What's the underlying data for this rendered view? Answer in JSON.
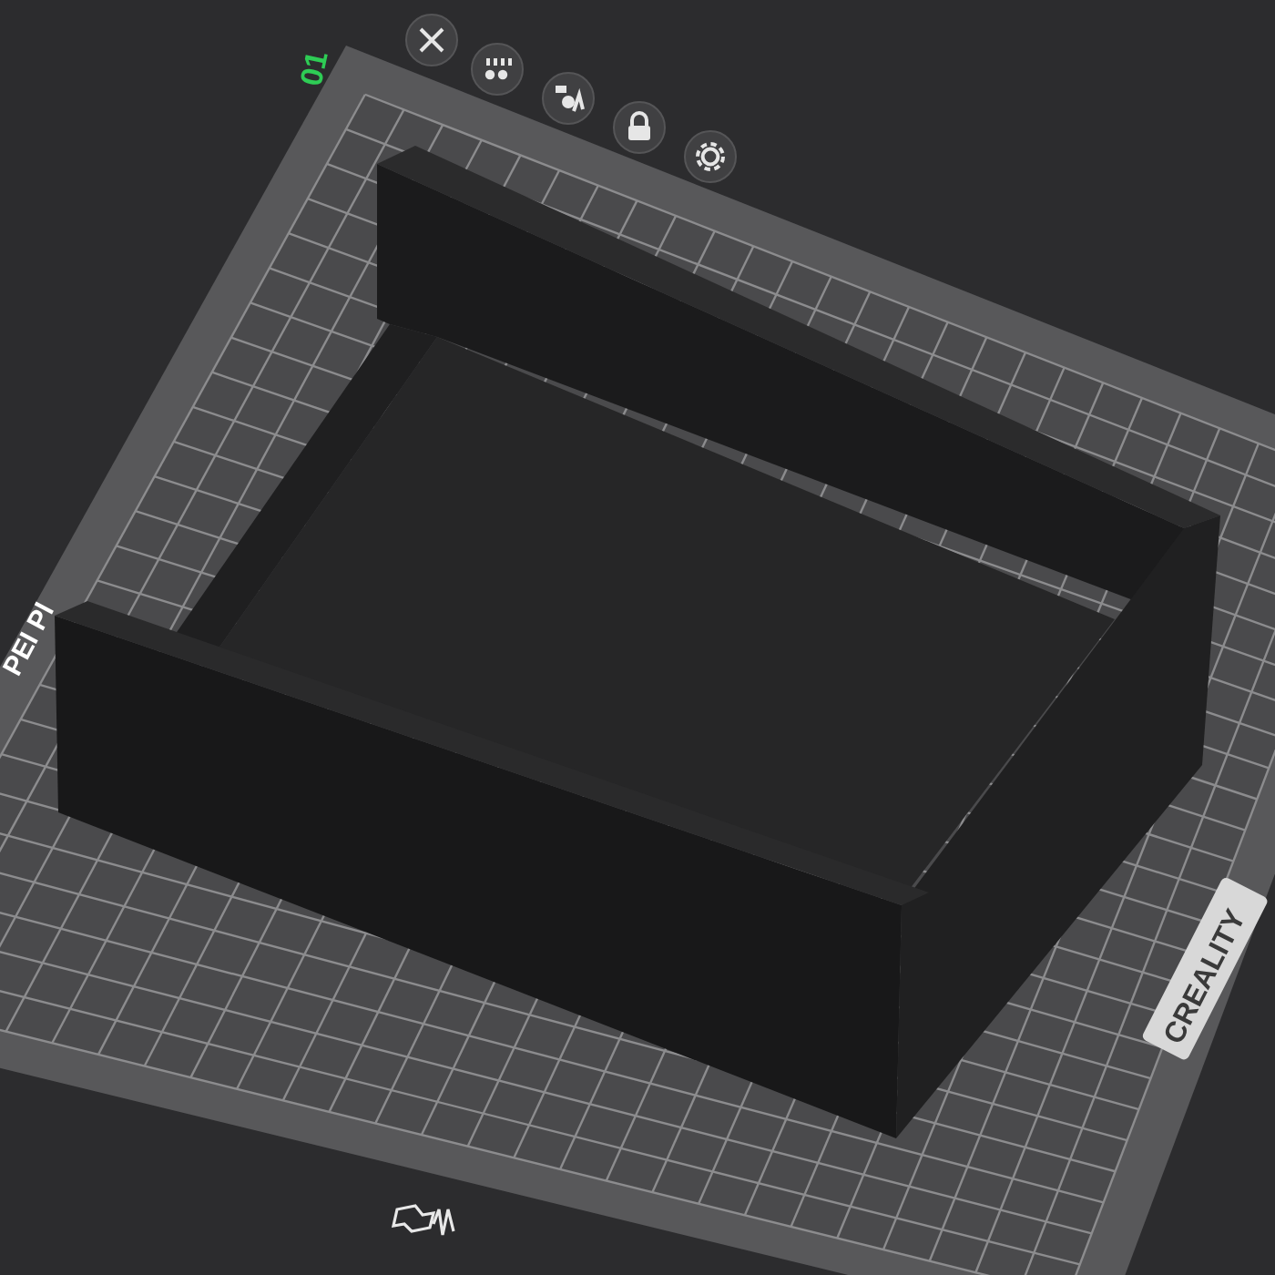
{
  "plate": {
    "index": "01",
    "name": "PEI Pl",
    "brand": "CREALITY"
  }
}
